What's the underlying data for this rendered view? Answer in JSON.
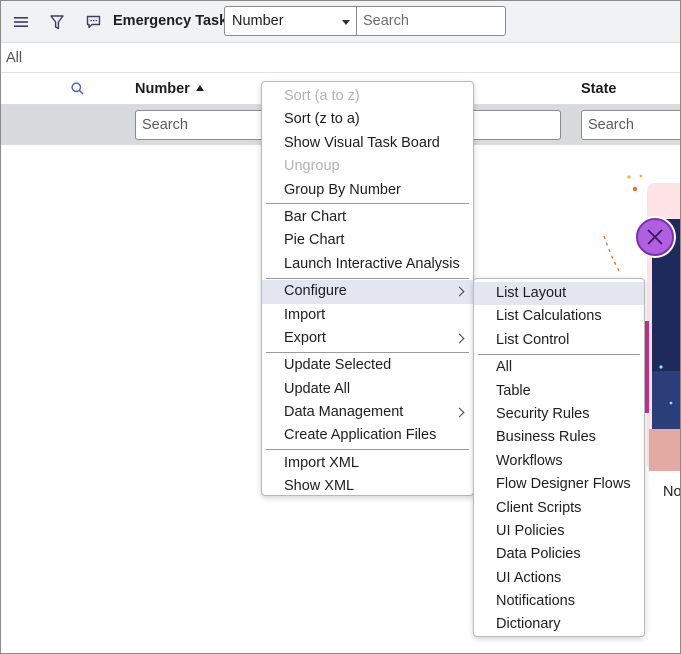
{
  "header": {
    "title": "Emergency Tasks",
    "field_select": "Number",
    "search_placeholder": "Search"
  },
  "breadcrumb": {
    "label": "All"
  },
  "columns": {
    "number": "Number",
    "state": "State"
  },
  "filters": {
    "number_placeholder": "Search",
    "middle_placeholder": "",
    "state_placeholder": "Search"
  },
  "empty_state": {
    "label": "No"
  },
  "context_menu": {
    "items": [
      {
        "label": "Sort (a to z)",
        "disabled": true
      },
      {
        "label": "Sort (z to a)"
      },
      {
        "label": "Show Visual Task Board"
      },
      {
        "label": "Ungroup",
        "disabled": true
      },
      {
        "label": "Group By Number"
      },
      {
        "label": "Bar Chart"
      },
      {
        "label": "Pie Chart"
      },
      {
        "label": "Launch Interactive Analysis"
      },
      {
        "label": "Configure",
        "submenu": true,
        "highlighted": true
      },
      {
        "label": "Import"
      },
      {
        "label": "Export",
        "submenu": true
      },
      {
        "label": "Update Selected"
      },
      {
        "label": "Update All"
      },
      {
        "label": "Data Management",
        "submenu": true
      },
      {
        "label": "Create Application Files"
      },
      {
        "label": "Import XML"
      },
      {
        "label": "Show XML"
      }
    ]
  },
  "configure_submenu": {
    "items": [
      {
        "label": "List Layout",
        "highlighted": true
      },
      {
        "label": "List Calculations"
      },
      {
        "label": "List Control"
      },
      {
        "label": "All"
      },
      {
        "label": "Table"
      },
      {
        "label": "Security Rules"
      },
      {
        "label": "Business Rules"
      },
      {
        "label": "Workflows"
      },
      {
        "label": "Flow Designer Flows"
      },
      {
        "label": "Client Scripts"
      },
      {
        "label": "UI Policies"
      },
      {
        "label": "Data Policies"
      },
      {
        "label": "UI Actions"
      },
      {
        "label": "Notifications"
      },
      {
        "label": "Dictionary"
      }
    ]
  },
  "colors": {
    "header_bg": "#f1f2f4",
    "filter_row_bg": "#d9dadd",
    "menu_highlight": "#e3e6f1",
    "accent_purple": "#b05fe0"
  }
}
